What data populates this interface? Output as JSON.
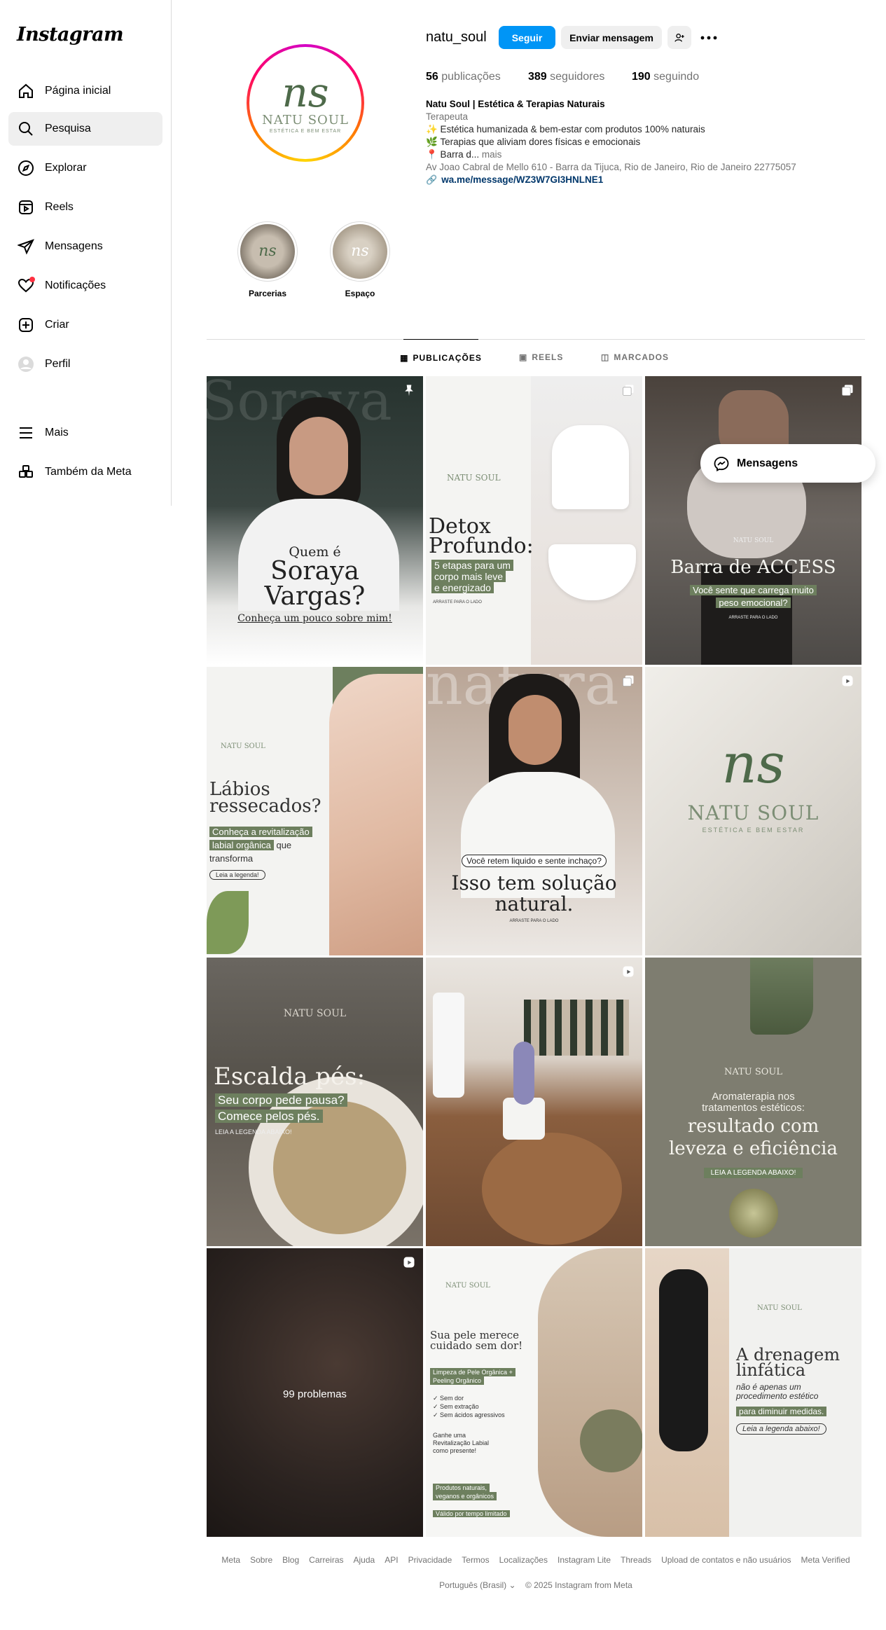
{
  "brand": "Instagram",
  "nav": [
    {
      "label": "Página inicial",
      "icon": "home-icon"
    },
    {
      "label": "Pesquisa",
      "icon": "search-icon"
    },
    {
      "label": "Explorar",
      "icon": "compass-icon"
    },
    {
      "label": "Reels",
      "icon": "reels-icon"
    },
    {
      "label": "Mensagens",
      "icon": "send-icon"
    },
    {
      "label": "Notificações",
      "icon": "heart-icon"
    },
    {
      "label": "Criar",
      "icon": "plus-square-icon"
    },
    {
      "label": "Perfil",
      "icon": "avatar-icon"
    },
    {
      "label": "Mais",
      "icon": "menu-icon"
    },
    {
      "label": "Também da Meta",
      "icon": "meta-apps-icon"
    }
  ],
  "profile": {
    "username": "natu_soul",
    "follow_label": "Seguir",
    "message_label": "Enviar mensagem",
    "posts_count": "56",
    "posts_label": "publicações",
    "followers_count": "389",
    "followers_label": "seguidores",
    "following_count": "190",
    "following_label": "seguindo",
    "name": "Natu Soul | Estética & Terapias Naturais",
    "category": "Terapeuta",
    "bio_line1": "✨ Estética humanizada & bem-estar com produtos 100% naturais",
    "bio_line2": "🌿 Terapias que aliviam dores físicas e emocionais",
    "bio_line3": "📍 Barra d...",
    "bio_more": "mais",
    "address": "Av Joao Cabral de Mello 610 - Barra da Tijuca, Rio de Janeiro, Rio de Janeiro 22775057",
    "link": "wa.me/message/WZ3W7GI3HNLNE1",
    "avatar_mark": "ns",
    "avatar_brand": "NATU SOUL",
    "avatar_sub": "ESTÉTICA E BEM ESTAR"
  },
  "highlights": [
    {
      "label": "Parcerias"
    },
    {
      "label": "Espaço"
    }
  ],
  "tabs": [
    {
      "label": "PUBLICAÇÕES"
    },
    {
      "label": "REELS"
    },
    {
      "label": "MARCADOS"
    }
  ],
  "posts": {
    "p1": {
      "bg_word": "Soraya",
      "l1": "Quem é",
      "l2": "Soraya",
      "l3": "Vargas?",
      "l4": "Conheça um pouco sobre mim!"
    },
    "p2": {
      "brand": "NATU SOUL",
      "t1": "Detox",
      "t2": "Profundo:",
      "t3": "5 etapas para um",
      "t4": "corpo mais leve",
      "t5": "e energizado",
      "t6": "ARRASTE PARA O LADO"
    },
    "p3": {
      "brand": "NATU SOUL",
      "t1": "Barra de ACCESS",
      "t2": "Você sente que carrega muito",
      "t3": "peso emocional?",
      "t4": "ARRASTE PARA O LADO"
    },
    "p4": {
      "brand": "NATU SOUL",
      "t1": "Lábios",
      "t2": "ressecados?",
      "t3": "Conheça a revitalização",
      "t4": "labial orgânica",
      "t5": "que",
      "t6": "transforma",
      "t7": "Leia a legenda!"
    },
    "p5": {
      "bg_word": "natura",
      "t1": "Você retem liquido e sente inchaço?",
      "t2": "Isso tem solução",
      "t3": "natural.",
      "t4": "ARRASTE PARA O LADO"
    },
    "p6": {
      "mark": "ns",
      "brand": "NATU SOUL",
      "sub": "ESTÉTICA E BEM ESTAR"
    },
    "p7": {
      "brand": "NATU SOUL",
      "t1": "Escalda pés:",
      "t2": "Seu corpo pede pausa?",
      "t3": "Comece pelos pés.",
      "t4": "LEIA A LEGENDA ABAIXO!"
    },
    "p9": {
      "brand": "NATU SOUL",
      "t1": "Aromaterapia nos",
      "t2": "tratamentos estéticos:",
      "t3": "resultado com",
      "t4": "leveza e eficiência",
      "t5": "LEIA A LEGENDA ABAIXO!"
    },
    "p10": {
      "t1": "99 problemas"
    },
    "p11": {
      "brand": "NATU SOUL",
      "t1": "Sua pele merece",
      "t2": "cuidado sem dor!",
      "t3": "Limpeza de Pele Orgânica +",
      "t4": "Peeling Orgânico",
      "t5": "Sem dor",
      "t6": "Sem extração",
      "t7": "Sem ácidos agressivos",
      "t8": "Ganhe uma",
      "t9": "Revitalização Labial",
      "t10": "como presente!",
      "t11": "Produtos naturais,",
      "t12": "veganos e orgânicos",
      "t13": "Válido por tempo limitado"
    },
    "p12": {
      "brand": "NATU SOUL",
      "t1": "A drenagem",
      "t2": "linfática",
      "t3": "não é apenas um",
      "t4": "procedimento estético",
      "t5": "para diminuir medidas.",
      "t6": "Leia a legenda abaixo!"
    }
  },
  "float": {
    "label": "Mensagens"
  },
  "footer": {
    "links": [
      "Meta",
      "Sobre",
      "Blog",
      "Carreiras",
      "Ajuda",
      "API",
      "Privacidade",
      "Termos",
      "Localizações",
      "Instagram Lite",
      "Threads",
      "Upload de contatos e não usuários",
      "Meta Verified"
    ],
    "language": "Português (Brasil)",
    "copyright": "© 2025 Instagram from Meta"
  },
  "colors": {
    "accent": "#0095f6",
    "brand_green": "#6d7f5e",
    "notification": "#ff3040"
  }
}
